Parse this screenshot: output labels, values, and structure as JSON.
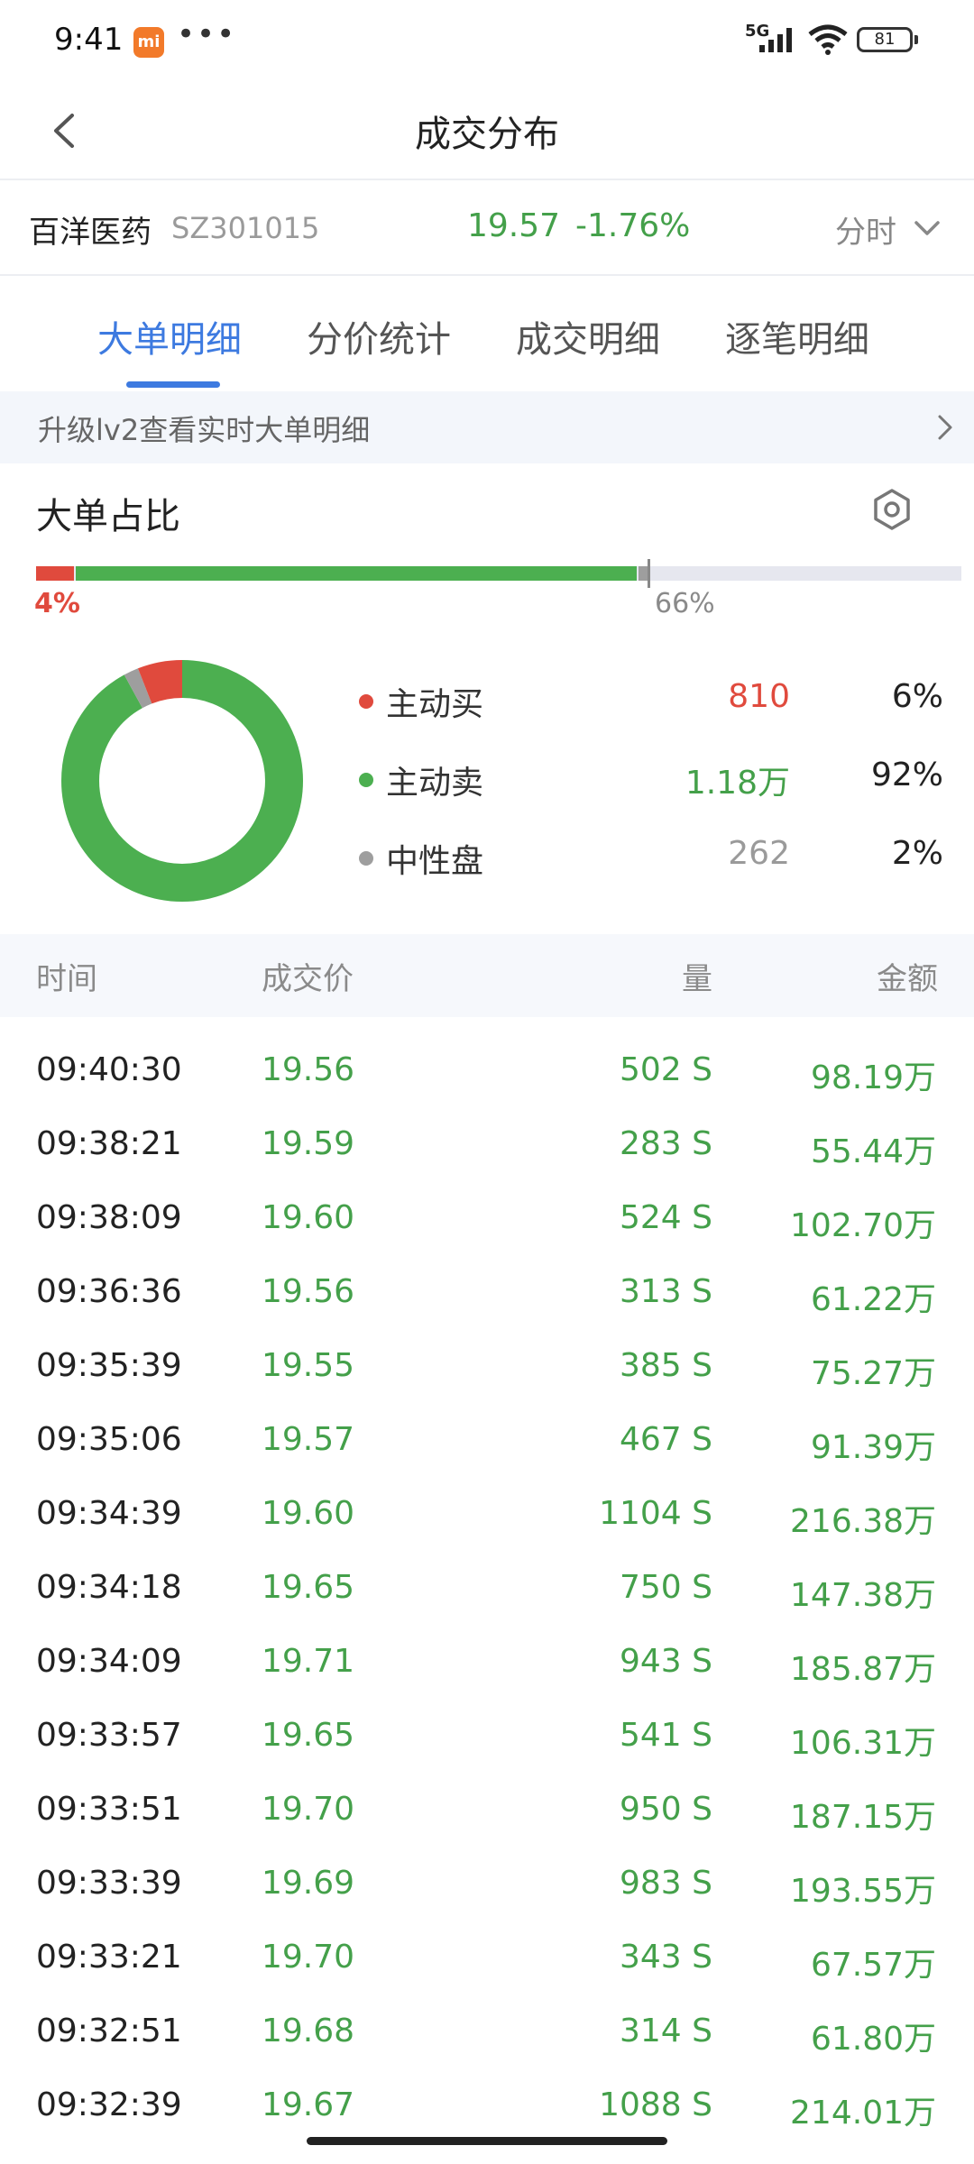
{
  "status_bar": {
    "time": "9:41",
    "app_badge": "mi",
    "dots": "•••",
    "network": "5G",
    "battery": "81"
  },
  "nav": {
    "title": "成交分布"
  },
  "stock": {
    "name": "百洋医药",
    "code": "SZ301015",
    "price": "19.57",
    "change": "-1.76%",
    "period": "分时"
  },
  "tabs": [
    "大单明细",
    "分价统计",
    "成交明细",
    "逐笔明细"
  ],
  "banner": {
    "text": "升级lv2查看实时大单明细"
  },
  "ratio_section": {
    "title": "大单占比",
    "bar": {
      "buy_fraction": 0.04,
      "sell_fraction": 0.62,
      "neutral_fraction": 0.01,
      "left_label": "4%",
      "right_label": "66%"
    },
    "legend": [
      {
        "label": "主动买",
        "count": "810",
        "pct": "6%",
        "color": "#e04a3d",
        "fraction": 0.06
      },
      {
        "label": "主动卖",
        "count": "1.18万",
        "pct": "92%",
        "color": "#4caf50",
        "fraction": 0.92
      },
      {
        "label": "中性盘",
        "count": "262",
        "pct": "2%",
        "color": "#9e9e9e",
        "fraction": 0.02
      }
    ]
  },
  "table": {
    "headers": {
      "time": "时间",
      "price": "成交价",
      "volume": "量",
      "amount": "金额"
    },
    "rows": [
      {
        "time": "09:40:30",
        "price": "19.56",
        "volume": "502 S",
        "amount": "98.19万"
      },
      {
        "time": "09:38:21",
        "price": "19.59",
        "volume": "283 S",
        "amount": "55.44万"
      },
      {
        "time": "09:38:09",
        "price": "19.60",
        "volume": "524 S",
        "amount": "102.70万"
      },
      {
        "time": "09:36:36",
        "price": "19.56",
        "volume": "313 S",
        "amount": "61.22万"
      },
      {
        "time": "09:35:39",
        "price": "19.55",
        "volume": "385 S",
        "amount": "75.27万"
      },
      {
        "time": "09:35:06",
        "price": "19.57",
        "volume": "467 S",
        "amount": "91.39万"
      },
      {
        "time": "09:34:39",
        "price": "19.60",
        "volume": "1104 S",
        "amount": "216.38万"
      },
      {
        "time": "09:34:18",
        "price": "19.65",
        "volume": "750 S",
        "amount": "147.38万"
      },
      {
        "time": "09:34:09",
        "price": "19.71",
        "volume": "943 S",
        "amount": "185.87万"
      },
      {
        "time": "09:33:57",
        "price": "19.65",
        "volume": "541 S",
        "amount": "106.31万"
      },
      {
        "time": "09:33:51",
        "price": "19.70",
        "volume": "950 S",
        "amount": "187.15万"
      },
      {
        "time": "09:33:39",
        "price": "19.69",
        "volume": "983 S",
        "amount": "193.55万"
      },
      {
        "time": "09:33:21",
        "price": "19.70",
        "volume": "343 S",
        "amount": "67.57万"
      },
      {
        "time": "09:32:51",
        "price": "19.68",
        "volume": "314 S",
        "amount": "61.80万"
      },
      {
        "time": "09:32:39",
        "price": "19.67",
        "volume": "1088 S",
        "amount": "214.01万"
      }
    ]
  }
}
